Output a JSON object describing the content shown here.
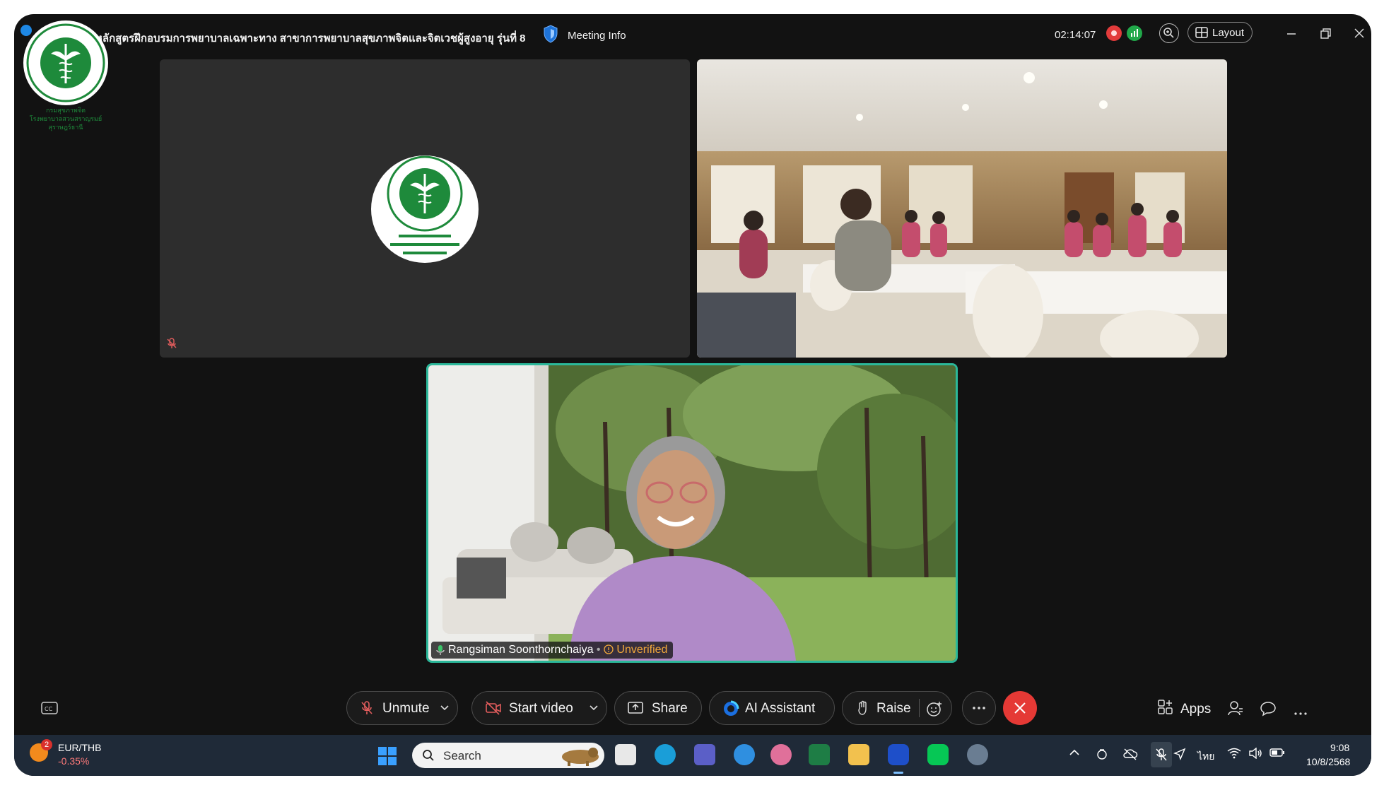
{
  "window": {
    "title": "หลักสูตรฝึกอบรมการพยาบาลเฉพาะทาง สาขาการพยาบาลสุขภาพจิตและจิตเวชผู้สูงอายุ รุ่นที่ 8",
    "meeting_info_label": "Meeting Info",
    "timer": "02:14:07",
    "layout_label": "Layout"
  },
  "logo": {
    "org_th": "กระทรวงสาธารณสุข",
    "org_en": "MINISTRY OF PUBLIC HEALTH",
    "caption": [
      "กรมสุขภาพจิต",
      "โรงพยาบาลสวนสราญรมย์",
      "สุราษฎร์ธานี"
    ]
  },
  "participants": {
    "speaker_name": "Rangsiman Soonthornchaiya",
    "speaker_status": "Unverified"
  },
  "controls": {
    "unmute": "Unmute",
    "start_video": "Start video",
    "share": "Share",
    "ai_assistant": "AI Assistant",
    "raise": "Raise",
    "apps": "Apps"
  },
  "taskbar": {
    "ticker_name": "EUR/THB",
    "ticker_change": "-0.35%",
    "notification_count": "2",
    "search_placeholder": "Search",
    "language": "ไทย",
    "time": "9:08",
    "date": "10/8/2568"
  },
  "colors": {
    "speaker_border": "#2bb89a",
    "end_call": "#e53935",
    "unverified": "#f2a83b",
    "logo_green": "#1e8a3b"
  }
}
